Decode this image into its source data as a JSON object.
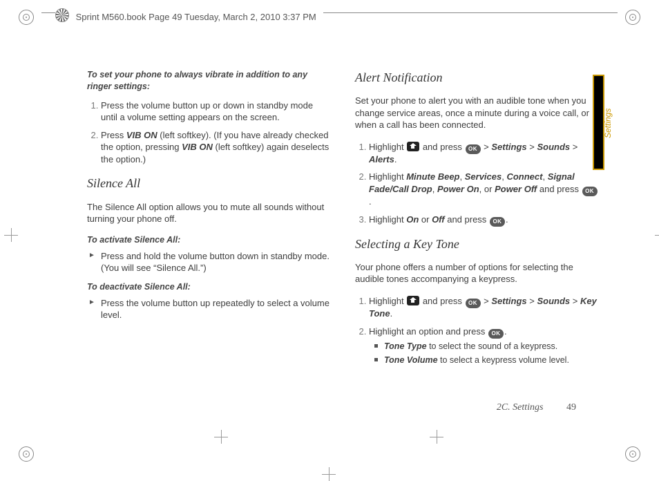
{
  "header": {
    "text": "Sprint M560.book  Page 49  Tuesday, March 2, 2010  3:37 PM"
  },
  "left": {
    "intro": "To set your phone to always vibrate in addition to any ringer settings:",
    "step1": "Press the volume button up or down in standby mode until a volume setting appears on the screen.",
    "step2a": "Press ",
    "step2b": "VIB ON",
    "step2c": " (left softkey). (If you have already checked the option, pressing ",
    "step2d": "VIB ON",
    "step2e": " (left softkey) again deselects the option.)",
    "h_silence": "Silence All",
    "silence_p": "The Silence All option allows you to mute all sounds without turning your phone off.",
    "silence_act": "To activate Silence All:",
    "silence_act_b": "Press and hold the volume button down in standby mode. (You will see “Silence All.”)",
    "silence_deact": "To deactivate Silence All:",
    "silence_deact_b": "Press the volume button up repeatedly to select a volume level."
  },
  "right": {
    "h_alert": "Alert Notification",
    "alert_p": "Set your phone to alert you with an audible tone when you change service areas, once a minute during a voice call, or when a call has been connected.",
    "a1a": "Highlight ",
    "a1b": " and press ",
    "a1c": " > ",
    "a1_s": "Settings",
    "a1d": " > ",
    "a1_so": "Sounds",
    "a1e": " > ",
    "a1_al": "Alerts",
    "a1f": ".",
    "a2a": "Highlight ",
    "a2_mb": "Minute Beep",
    "a2b": ", ",
    "a2_sv": "Services",
    "a2c": ", ",
    "a2_cn": "Connect",
    "a2d": ", ",
    "a2_sf": "Signal Fade/Call Drop",
    "a2e": ", ",
    "a2_po": "Power On",
    "a2f": ", or ",
    "a2_pf": "Power Off",
    "a2g": " and press ",
    "a2h": ".",
    "a3a": "Highlight ",
    "a3_on": "On",
    "a3b": " or ",
    "a3_off": "Off",
    "a3c": " and press ",
    "a3d": ".",
    "h_key": "Selecting a Key Tone",
    "key_p": "Your phone offers a number of options for selecting the audible tones accompanying a keypress.",
    "k1a": "Highlight ",
    "k1b": " and press ",
    "k1c": " > ",
    "k1_s": "Settings",
    "k1d": " > ",
    "k1_so": "Sounds",
    "k1e": " > ",
    "k1_kt": "Key Tone",
    "k1f": ".",
    "k2a": "Highlight an option and press ",
    "k2b": ".",
    "k2_tt": "Tone Type",
    "k2_tt2": " to select the sound of a keypress.",
    "k2_tv": "Tone Volume",
    "k2_tv2": " to select a keypress volume level."
  },
  "tab": "Settings",
  "footer_section": "2C. Settings",
  "footer_page": "49",
  "ok": "OK"
}
